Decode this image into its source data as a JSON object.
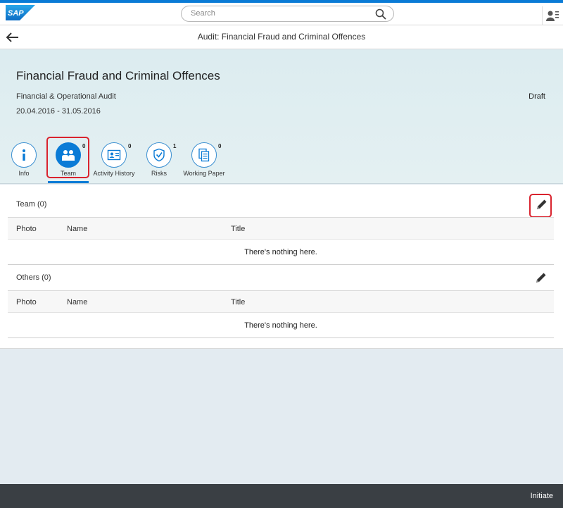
{
  "shell": {
    "logo_text": "SAP",
    "search_placeholder": "Search",
    "search_icon": "search-icon",
    "user_icon": "user-icon"
  },
  "page": {
    "title": "Audit: Financial Fraud and Criminal Offences",
    "back_icon": "back-arrow-icon"
  },
  "header": {
    "title": "Financial Fraud and Criminal Offences",
    "subtitle": "Financial & Operational Audit",
    "date_range": "20.04.2016 - 31.05.2016",
    "status": "Draft"
  },
  "tabs": [
    {
      "label": "Info",
      "count": "",
      "icon": "info-icon"
    },
    {
      "label": "Team",
      "count": "0",
      "icon": "team-icon",
      "selected": true
    },
    {
      "label": "Activity History",
      "count": "0",
      "icon": "contact-card-icon"
    },
    {
      "label": "Risks",
      "count": "1",
      "icon": "risk-icon"
    },
    {
      "label": "Working Paper",
      "count": "0",
      "icon": "documents-icon"
    }
  ],
  "team": {
    "title": "Team (0)",
    "columns": [
      "Photo",
      "Name",
      "Title"
    ],
    "empty_text": "There's nothing here."
  },
  "others": {
    "title": "Others (0)",
    "columns": [
      "Photo",
      "Name",
      "Title"
    ],
    "empty_text": "There's nothing here."
  },
  "footer": {
    "initiate_label": "Initiate"
  },
  "colors": {
    "accent": "#0a7bd6",
    "highlight": "#d9232e",
    "footer": "#3a3f44"
  }
}
